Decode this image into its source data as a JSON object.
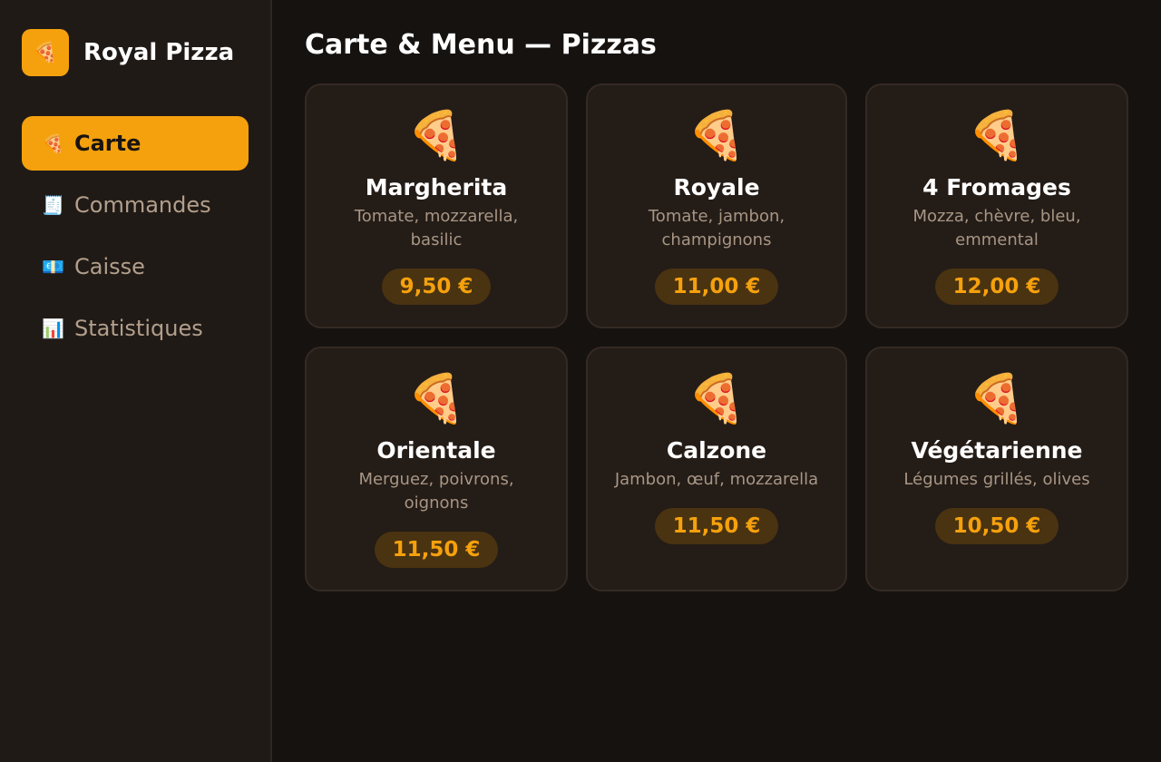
{
  "brand": {
    "logo": "🍕",
    "name": "Royal Pizza"
  },
  "sidebar": {
    "items": [
      {
        "icon": "🍕",
        "label": "Carte",
        "active": true
      },
      {
        "icon": "🧾",
        "label": "Commandes",
        "active": false
      },
      {
        "icon": "💶",
        "label": "Caisse",
        "active": false
      },
      {
        "icon": "📊",
        "label": "Statistiques",
        "active": false
      }
    ]
  },
  "main": {
    "title": "Carte & Menu — Pizzas",
    "pizzas": [
      {
        "icon": "🍕",
        "name": "Margherita",
        "desc": "Tomate, mozzarella, basilic",
        "price": "9,50 €"
      },
      {
        "icon": "🍕",
        "name": "Royale",
        "desc": "Tomate, jambon, champignons",
        "price": "11,00 €"
      },
      {
        "icon": "🍕",
        "name": "4 Fromages",
        "desc": "Mozza, chèvre, bleu, emmental",
        "price": "12,00 €"
      },
      {
        "icon": "🍕",
        "name": "Orientale",
        "desc": "Merguez, poivrons, oignons",
        "price": "11,50 €"
      },
      {
        "icon": "🍕",
        "name": "Calzone",
        "desc": "Jambon, œuf, mozzarella",
        "price": "11,50 €"
      },
      {
        "icon": "🍕",
        "name": "Végétarienne",
        "desc": "Légumes grillés, olives",
        "price": "10,50 €"
      }
    ]
  },
  "colors": {
    "accent": "#f5a10d",
    "sidebar_bg": "#201a16",
    "page_bg": "#161210",
    "card_bg": "#241c17"
  }
}
